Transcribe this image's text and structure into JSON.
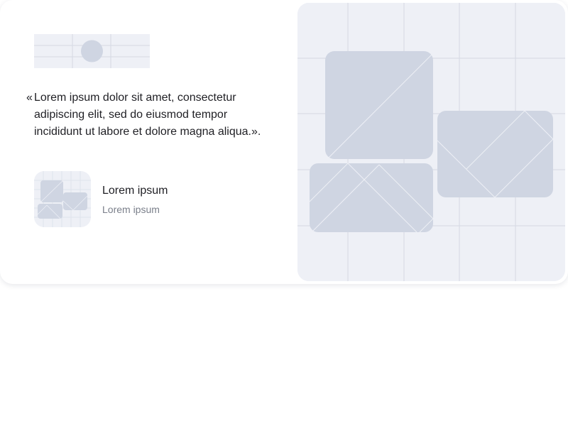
{
  "testimonial": {
    "quote_open": "«",
    "quote_text": "Lorem ipsum dolor sit amet, consectetur adipiscing elit, sed do eiusmod tempor incididunt ut labore et dolore magna aliqua.».",
    "author_name": "Lorem ipsum",
    "author_role": "Lorem ipsum"
  },
  "colors": {
    "placeholder_bg": "#eef0f6",
    "placeholder_shape": "#cfd5e2",
    "grid_line": "#d5d9e3",
    "text_primary": "#1f1f24",
    "text_secondary": "#7a7f8a"
  }
}
